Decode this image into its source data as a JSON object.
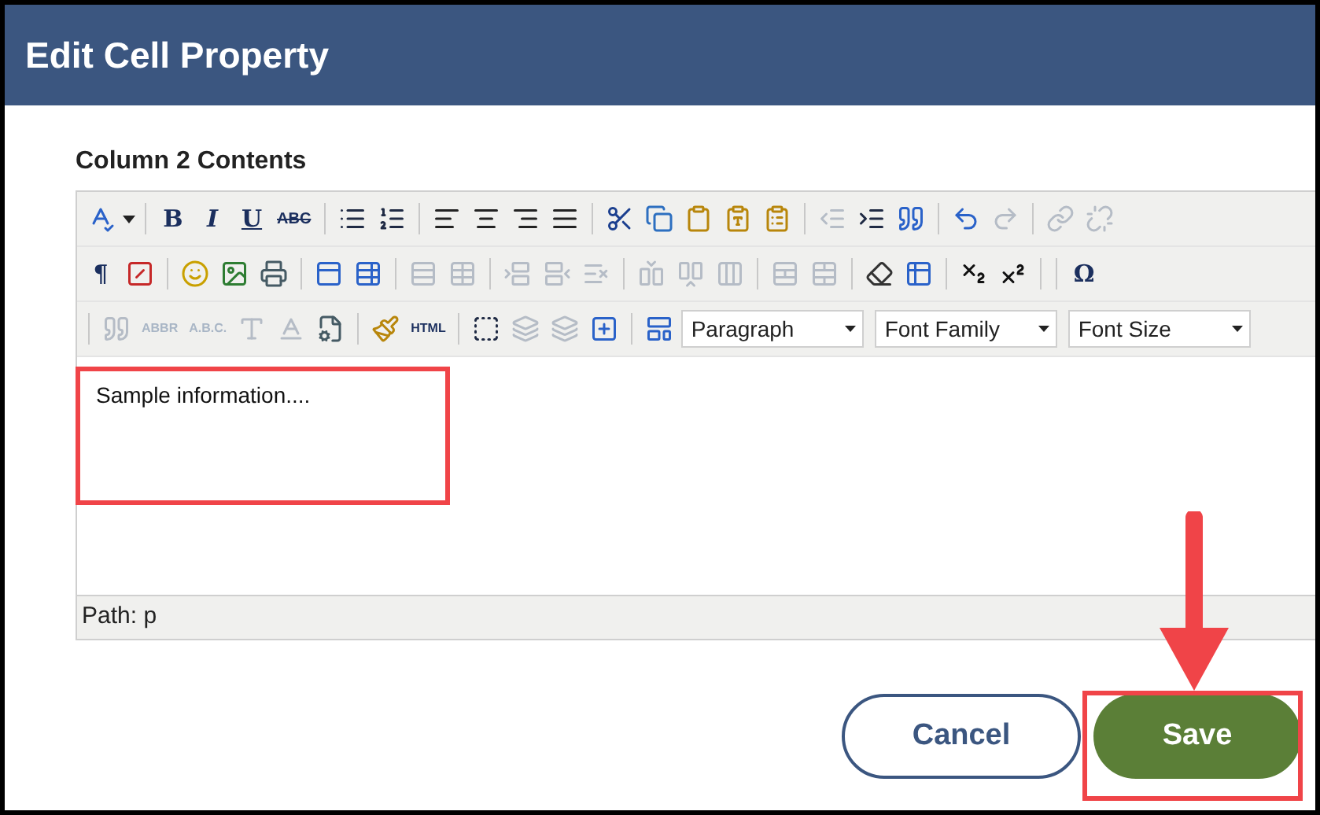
{
  "dialog": {
    "title": "Edit Cell Property"
  },
  "field_label": "Column 2 Contents",
  "toolbar": {
    "rows": [
      {
        "items": [
          {
            "kind": "icon",
            "disabled": false
          },
          {
            "kind": "caret",
            "disabled": false
          },
          {
            "kind": "sep"
          },
          {
            "kind": "bold",
            "label": "B",
            "disabled": false
          },
          {
            "kind": "italic",
            "label": "I",
            "disabled": false
          },
          {
            "kind": "underline",
            "label": "U",
            "disabled": false
          },
          {
            "kind": "strike",
            "label": "ABC",
            "disabled": false
          },
          {
            "kind": "sep"
          },
          {
            "kind": "icon",
            "disabled": false
          },
          {
            "kind": "icon",
            "disabled": false
          },
          {
            "kind": "sep"
          },
          {
            "kind": "icon",
            "disabled": false
          },
          {
            "kind": "icon",
            "disabled": false
          },
          {
            "kind": "icon",
            "disabled": false
          },
          {
            "kind": "icon",
            "disabled": false
          },
          {
            "kind": "sep"
          },
          {
            "kind": "icon",
            "disabled": false
          },
          {
            "kind": "icon",
            "disabled": false
          },
          {
            "kind": "icon",
            "disabled": false
          },
          {
            "kind": "icon",
            "disabled": false
          },
          {
            "kind": "icon",
            "disabled": false
          },
          {
            "kind": "sep"
          },
          {
            "kind": "icon",
            "disabled": true
          },
          {
            "kind": "icon",
            "disabled": false
          },
          {
            "kind": "icon",
            "disabled": false
          },
          {
            "kind": "sep"
          },
          {
            "kind": "icon",
            "disabled": false
          },
          {
            "kind": "icon",
            "disabled": true
          },
          {
            "kind": "sep"
          },
          {
            "kind": "icon",
            "disabled": true
          },
          {
            "kind": "icon",
            "disabled": true
          }
        ]
      },
      {
        "items": [
          {
            "kind": "glyph",
            "label": "¶",
            "disabled": false
          },
          {
            "kind": "icon",
            "disabled": false
          },
          {
            "kind": "sep"
          },
          {
            "kind": "icon",
            "disabled": false
          },
          {
            "kind": "icon",
            "disabled": false
          },
          {
            "kind": "icon",
            "disabled": false
          },
          {
            "kind": "sep"
          },
          {
            "kind": "icon",
            "disabled": false
          },
          {
            "kind": "icon",
            "disabled": false
          },
          {
            "kind": "sep"
          },
          {
            "kind": "icon",
            "disabled": true
          },
          {
            "kind": "icon",
            "disabled": true
          },
          {
            "kind": "sep"
          },
          {
            "kind": "icon",
            "disabled": true
          },
          {
            "kind": "icon",
            "disabled": true
          },
          {
            "kind": "icon",
            "disabled": true
          },
          {
            "kind": "sep"
          },
          {
            "kind": "icon",
            "disabled": true
          },
          {
            "kind": "icon",
            "disabled": true
          },
          {
            "kind": "icon",
            "disabled": true
          },
          {
            "kind": "sep"
          },
          {
            "kind": "icon",
            "disabled": true
          },
          {
            "kind": "icon",
            "disabled": true
          },
          {
            "kind": "sep"
          },
          {
            "kind": "icon",
            "disabled": false
          },
          {
            "kind": "icon",
            "disabled": false
          },
          {
            "kind": "sep"
          },
          {
            "kind": "icon",
            "disabled": false
          },
          {
            "kind": "icon",
            "disabled": false
          },
          {
            "kind": "sep"
          },
          {
            "kind": "sep"
          },
          {
            "kind": "glyph",
            "label": "Ω",
            "disabled": false
          }
        ]
      },
      {
        "items": [
          {
            "kind": "sep"
          },
          {
            "kind": "icon",
            "disabled": true
          },
          {
            "kind": "tag",
            "label": "ABBR",
            "disabled": true
          },
          {
            "kind": "tag",
            "label": "A.B.C.",
            "disabled": true
          },
          {
            "kind": "icon",
            "disabled": true
          },
          {
            "kind": "icon",
            "disabled": true
          },
          {
            "kind": "icon",
            "disabled": false
          },
          {
            "kind": "sep"
          },
          {
            "kind": "icon",
            "disabled": false
          },
          {
            "kind": "tag",
            "label": "HTML",
            "disabled": false
          },
          {
            "kind": "sep"
          },
          {
            "kind": "icon",
            "disabled": false
          },
          {
            "kind": "icon",
            "disabled": true
          },
          {
            "kind": "icon",
            "disabled": true
          },
          {
            "kind": "icon",
            "disabled": false
          },
          {
            "kind": "sep"
          },
          {
            "kind": "icon",
            "disabled": false
          },
          {
            "kind": "select",
            "value": "Paragraph"
          },
          {
            "kind": "select",
            "value": "Font Family"
          },
          {
            "kind": "select",
            "value": "Font Size"
          }
        ]
      }
    ]
  },
  "content": "Sample information....",
  "status_path": "Path: p",
  "buttons": [
    {
      "kind": "secondary",
      "label": "Cancel"
    },
    {
      "kind": "primary",
      "label": "Save"
    }
  ]
}
